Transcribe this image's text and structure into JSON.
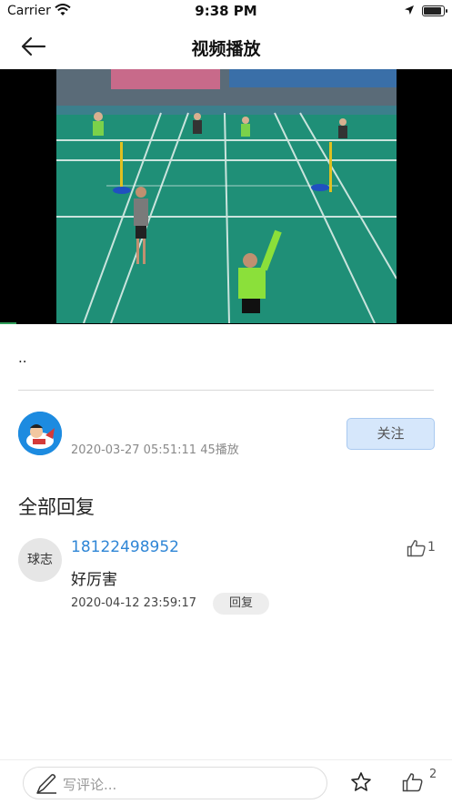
{
  "status_bar": {
    "carrier": "Carrier",
    "time": "9:38 PM"
  },
  "nav": {
    "title": "视频播放"
  },
  "video": {
    "description": ".."
  },
  "author": {
    "meta": "2020-03-27 05:51:11 45播放",
    "follow_label": "关注"
  },
  "comments_section": {
    "title": "全部回复",
    "comments": [
      {
        "avatar_text": "球志",
        "username": "18122498952",
        "text": "好厉害",
        "time": "2020-04-12 23:59:17",
        "reply_label": "回复",
        "likes": "1"
      }
    ]
  },
  "bottom_bar": {
    "input_placeholder": "写评论...",
    "like_count": "2"
  },
  "colors": {
    "accent_blue": "#2f86d6",
    "court_green": "#1f8f77",
    "follow_bg": "#d6e7fb"
  },
  "icons": [
    "wifi-icon",
    "location-arrow-icon",
    "battery-icon",
    "back-arrow-icon",
    "thumbs-up-icon",
    "pen-icon",
    "star-icon"
  ]
}
